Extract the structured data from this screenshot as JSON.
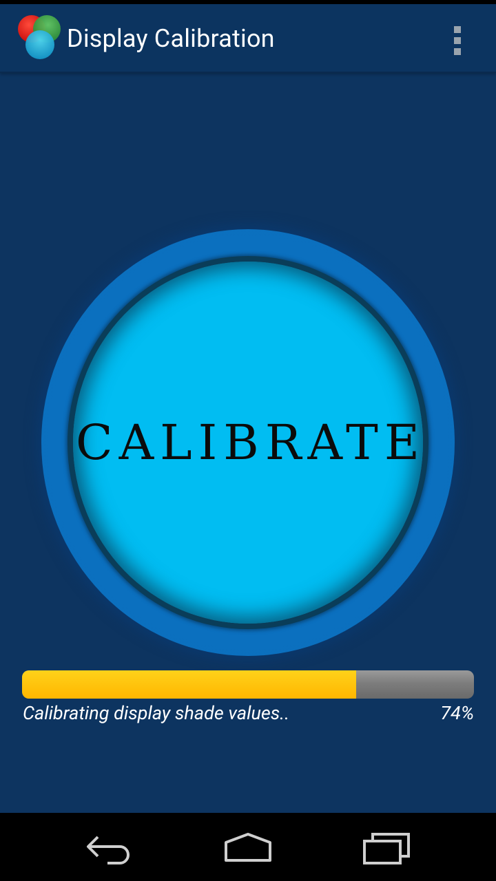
{
  "app": {
    "title": "Display Calibration",
    "icon": "rgb-circles-logo-icon",
    "menu_icon": "overflow-menu-icon"
  },
  "main": {
    "calibrate_label": "CALIBRATE"
  },
  "progress": {
    "percent": 74,
    "fraction": 0.74,
    "status_text": "Calibrating display shade values..",
    "percent_label": "74%",
    "fill_color": "#FFB600",
    "track_color": "#7D7D7D"
  },
  "nav": {
    "back_icon": "back-icon",
    "home_icon": "home-icon",
    "recents_icon": "recents-icon"
  },
  "colors": {
    "background": "#0D3460",
    "button_face": "#01BDF2",
    "button_ring": "#0B6FBE"
  }
}
